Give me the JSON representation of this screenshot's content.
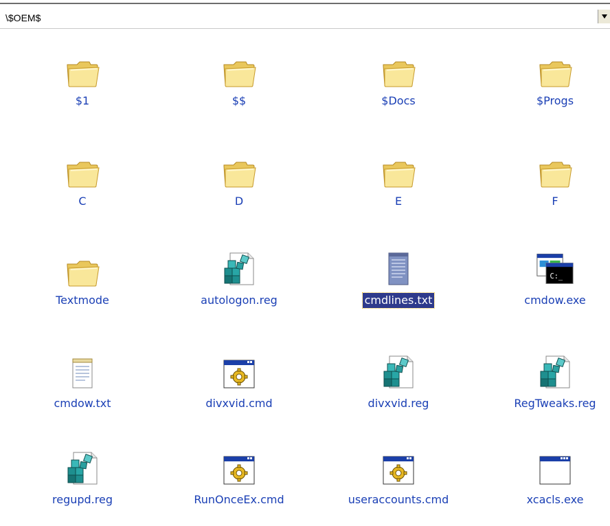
{
  "address": {
    "path": "\\$OEM$"
  },
  "items": [
    {
      "label": "$1",
      "icon": "folder-icon"
    },
    {
      "label": "$$",
      "icon": "folder-icon"
    },
    {
      "label": "$Docs",
      "icon": "folder-icon"
    },
    {
      "label": "$Progs",
      "icon": "folder-icon"
    },
    {
      "label": "C",
      "icon": "folder-icon"
    },
    {
      "label": "D",
      "icon": "folder-icon"
    },
    {
      "label": "E",
      "icon": "folder-icon"
    },
    {
      "label": "F",
      "icon": "folder-icon"
    },
    {
      "label": "Textmode",
      "icon": "folder-icon"
    },
    {
      "label": "autologon.reg",
      "icon": "registry-file-icon"
    },
    {
      "label": "cmdlines.txt",
      "icon": "text-document-icon",
      "selected": true
    },
    {
      "label": "cmdow.exe",
      "icon": "console-app-icon"
    },
    {
      "label": "cmdow.txt",
      "icon": "notepad-file-icon"
    },
    {
      "label": "divxvid.cmd",
      "icon": "batch-file-icon"
    },
    {
      "label": "divxvid.reg",
      "icon": "registry-file-icon"
    },
    {
      "label": "RegTweaks.reg",
      "icon": "registry-file-icon"
    },
    {
      "label": "regupd.reg",
      "icon": "registry-file-icon"
    },
    {
      "label": "RunOnceEx.cmd",
      "icon": "batch-file-icon"
    },
    {
      "label": "useraccounts.cmd",
      "icon": "batch-file-icon"
    },
    {
      "label": "xcacls.exe",
      "icon": "application-window-icon"
    }
  ],
  "colors": {
    "label_text": "#1a3fb5",
    "selection_bg": "#2e3a8c",
    "folder_yellow": "#f5dc7a"
  }
}
